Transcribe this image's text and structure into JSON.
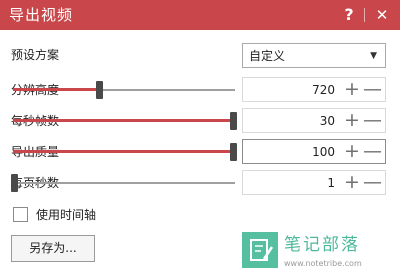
{
  "window": {
    "title": "导出视频",
    "help_symbol": "?",
    "close_symbol": "✕",
    "accent_color": "#c9474a"
  },
  "preset": {
    "label": "预设方案",
    "value": "自定义",
    "arrow": "▼"
  },
  "settings": [
    {
      "label": "分辨高度",
      "value": "720",
      "slider_fraction": 0.39
    },
    {
      "label": "每秒帧数",
      "value": "30",
      "slider_fraction": 1.0
    },
    {
      "label": "导出质量",
      "value": "100",
      "slider_fraction": 1.0
    },
    {
      "label": "每页秒数",
      "value": "1",
      "slider_fraction": 0.0
    }
  ],
  "stepper": {
    "plus": "+",
    "minus": "—"
  },
  "timeline": {
    "label": "使用时间轴",
    "checked": false
  },
  "save_as": {
    "label": "另存为..."
  },
  "watermark": {
    "title": "笔记部落",
    "url": "www.notetribe.com",
    "icon": "pencil-note-icon",
    "color": "#55bfa0"
  }
}
